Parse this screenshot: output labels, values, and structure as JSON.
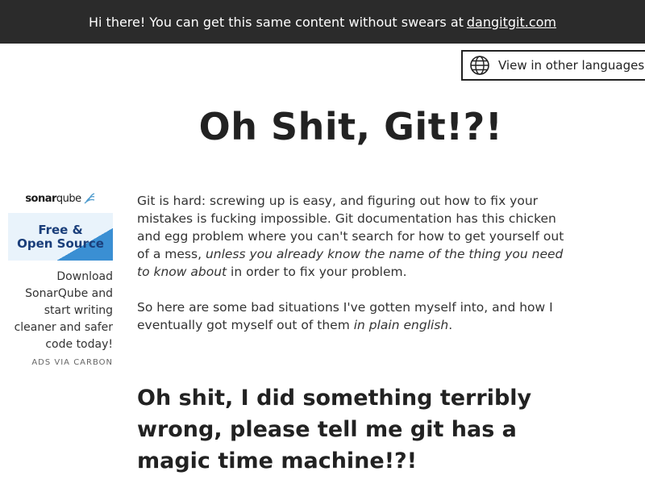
{
  "banner": {
    "text": "Hi there! You can get this same content without swears at",
    "link": "dangitgit.com"
  },
  "language": {
    "icon": "globe-icon",
    "label": "View in other languages"
  },
  "page": {
    "title": "Oh Shit, Git!?!"
  },
  "ad": {
    "brand_bold": "sonar",
    "brand_rest": "qube",
    "banner_line1": "Free &",
    "banner_line2": "Open Source",
    "text": "Download SonarQube and start writing cleaner and safer code today!",
    "via": "ADS VIA CARBON"
  },
  "intro": {
    "p1_a": "Git is hard: screwing up is easy, and figuring out how to fix your mistakes is fucking impossible. Git documentation has this chicken and egg problem where you can't search for how to get yourself out of a mess, ",
    "p1_em": "unless you already know the name of the thing you need to know about",
    "p1_b": " in order to fix your problem.",
    "p2_a": "So here are some bad situations I've gotten myself into, and how I eventually got myself out of them ",
    "p2_em": "in plain english",
    "p2_b": "."
  },
  "section": {
    "heading": "Oh shit, I did something terribly wrong, please tell me git has a magic time machine!?!"
  }
}
